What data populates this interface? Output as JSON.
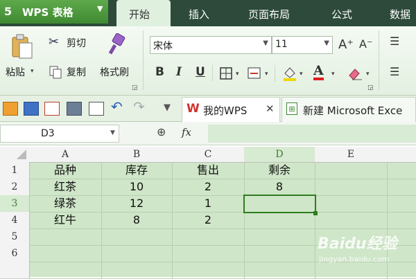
{
  "app": {
    "logo": "5",
    "name": "WPS 表格",
    "dropdown": "▼"
  },
  "menu_tabs": [
    "开始",
    "插入",
    "页面布局",
    "公式",
    "数据"
  ],
  "ribbon": {
    "paste_label": "粘贴",
    "cut_label": "剪切",
    "copy_label": "复制",
    "format_painter_label": "格式刷",
    "font_name": "宋体",
    "font_size": "11",
    "bold": "B",
    "italic": "I",
    "underline": "U",
    "increase_font": "A⁺",
    "decrease_font": "A⁻",
    "font_color_glyph": "A"
  },
  "doc_tabs": [
    {
      "label": "我的WPS",
      "close": "✕"
    },
    {
      "label": "新建 Microsoft Exce"
    }
  ],
  "formula_bar": {
    "cell_ref": "D3",
    "fx": "fx",
    "formula_value": ""
  },
  "sheet": {
    "columns": [
      "A",
      "B",
      "C",
      "D",
      "E"
    ],
    "rows": [
      "1",
      "2",
      "3",
      "4",
      "5",
      "6"
    ],
    "cells": [
      [
        "品种",
        "库存",
        "售出",
        "剩余",
        ""
      ],
      [
        "红茶",
        "10",
        "2",
        "8",
        ""
      ],
      [
        "绿茶",
        "12",
        "1",
        "",
        ""
      ],
      [
        "红牛",
        "8",
        "2",
        "",
        ""
      ],
      [
        "",
        "",
        "",
        "",
        ""
      ],
      [
        "",
        "",
        "",
        "",
        ""
      ]
    ],
    "selected_cell": "D3"
  },
  "watermark": {
    "brand": "Baidu经验",
    "url": "jingyan.baidu.com"
  },
  "colors": {
    "accent": "#3f8a31",
    "menubar": "#2d4a3a",
    "grid_fill": "#cfe6c8",
    "selection": "#2e7d1f"
  }
}
